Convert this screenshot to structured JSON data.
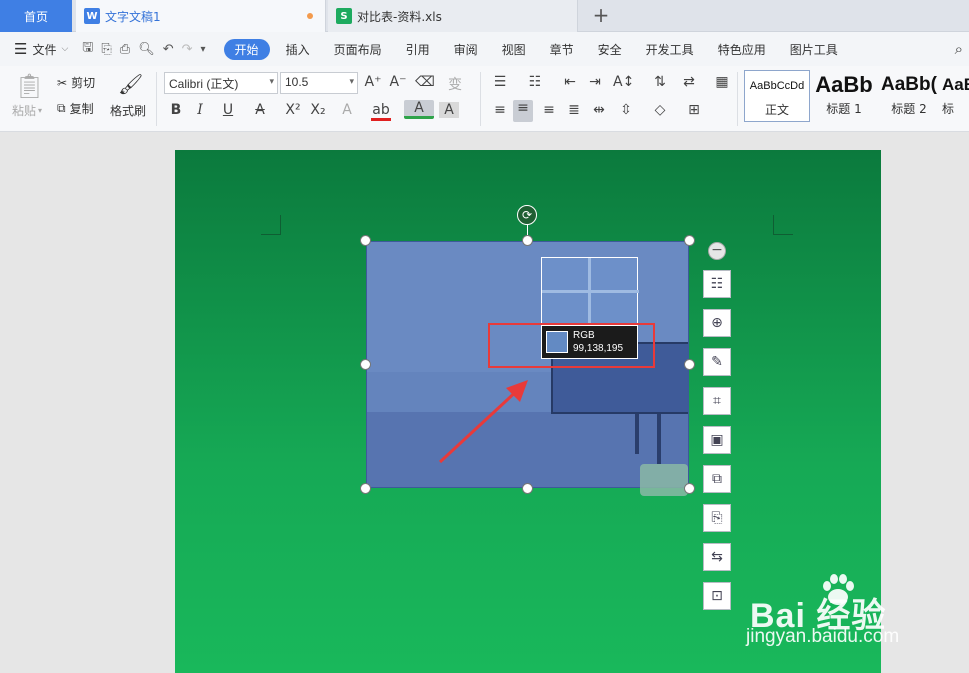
{
  "tabs": {
    "home": "首页",
    "doc1": "文字文稿1",
    "doc2": "对比表-资料.xls"
  },
  "menu": {
    "file": "文件",
    "items": [
      "开始",
      "插入",
      "页面布局",
      "引用",
      "审阅",
      "视图",
      "章节",
      "安全",
      "开发工具",
      "特色应用",
      "图片工具"
    ]
  },
  "ribbon": {
    "paste": "粘贴",
    "cut": "剪切",
    "copy": "复制",
    "format_painter": "格式刷",
    "font_name": "Calibri (正文)",
    "font_size": "10.5",
    "styles": [
      {
        "sample": "AaBbCcDd",
        "label": "正文"
      },
      {
        "sample": "AaBb",
        "label": "标题 1"
      },
      {
        "sample": "AaBb(",
        "label": "标题 2"
      },
      {
        "sample": "AaB",
        "label": "标"
      }
    ]
  },
  "picker": {
    "label": "RGB",
    "value": "99,138,195",
    "color": "#638ac3"
  },
  "colors": {
    "accent": "#3f7fe4",
    "highlight": "#e83a3a"
  },
  "watermark": {
    "brand": "Bai  经验",
    "url": "jingyan.baidu.com"
  }
}
